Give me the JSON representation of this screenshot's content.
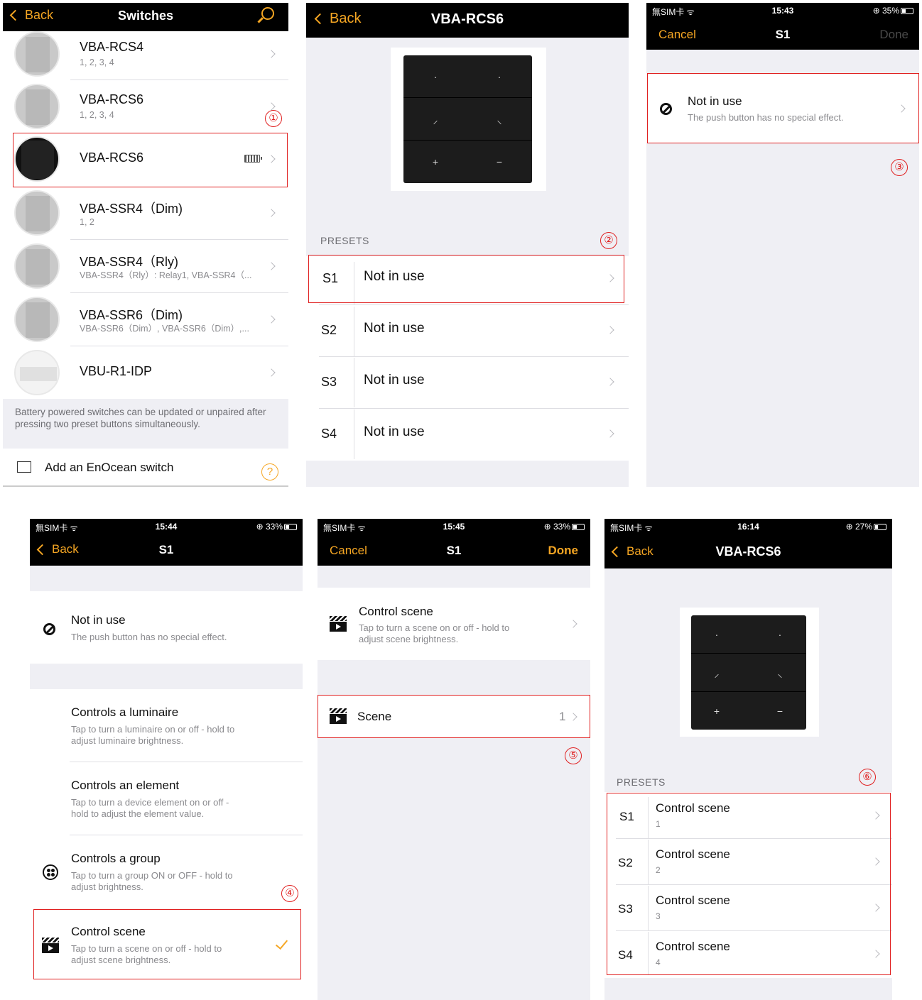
{
  "p1": {
    "back": "Back",
    "title": "Switches",
    "items": [
      {
        "name": "VBA-RCS4",
        "sub": "1, 2, 3, 4"
      },
      {
        "name": "VBA-RCS6",
        "sub": "1, 2, 3, 4"
      },
      {
        "name": "VBA-RCS6",
        "sub": ""
      },
      {
        "name": "VBA-SSR4（Dim)",
        "sub": "1, 2"
      },
      {
        "name": "VBA-SSR4（Rly)",
        "sub": "VBA-SSR4（Rly）: Relay1, VBA-SSR4（..."
      },
      {
        "name": "VBA-SSR6（Dim)",
        "sub": "VBA-SSR6（Dim）, VBA-SSR6（Dim）,..."
      },
      {
        "name": "VBU-R1-IDP",
        "sub": ""
      }
    ],
    "note": "Battery powered switches can be updated or unpaired after pressing two preset buttons simultaneously.",
    "add": "Add an EnOcean switch",
    "help": "?",
    "step": "①"
  },
  "p2": {
    "back": "Back",
    "title": "VBA-RCS6",
    "presets": "PRESETS",
    "step": "②",
    "rows": [
      {
        "s": "S1",
        "v": "Not in use"
      },
      {
        "s": "S2",
        "v": "Not in use"
      },
      {
        "s": "S3",
        "v": "Not in use"
      },
      {
        "s": "S4",
        "v": "Not in use"
      }
    ]
  },
  "device": {
    "keys": [
      "·",
      "·",
      "⸝",
      "⸜",
      "+",
      "−"
    ]
  },
  "p3": {
    "carrier": "無SIM卡 ᯤ",
    "time": "15:43",
    "battery": "⊕ 35%",
    "cancel": "Cancel",
    "title": "S1",
    "done": "Done",
    "item": {
      "name": "Not in use",
      "sub": "The push button has no special effect."
    },
    "step": "③"
  },
  "p4": {
    "carrier": "無SIM卡 ᯤ",
    "time": "15:44",
    "battery": "⊕ 33%",
    "back": "Back",
    "title": "S1",
    "first": {
      "name": "Not in use",
      "sub": "The push button has no special effect."
    },
    "items": [
      {
        "name": "Controls a luminaire",
        "sub1": "Tap to turn a luminaire on or off - hold to",
        "sub2": "adjust luminaire brightness."
      },
      {
        "name": "Controls an element",
        "sub1": "Tap to turn a device element on or off -",
        "sub2": "hold to adjust the element value."
      },
      {
        "name": "Controls a group",
        "sub1": "Tap to turn a group ON or OFF - hold to",
        "sub2": "adjust brightness."
      },
      {
        "name": "Control scene",
        "sub1": "Tap to turn a scene on or off - hold to",
        "sub2": "adjust scene brightness."
      }
    ],
    "step": "④"
  },
  "p5": {
    "carrier": "無SIM卡 ᯤ",
    "time": "15:45",
    "battery": "⊕ 33%",
    "cancel": "Cancel",
    "title": "S1",
    "done": "Done",
    "item": {
      "name": "Control scene",
      "sub1": "Tap to turn a scene on or off - hold to",
      "sub2": "adjust scene brightness."
    },
    "scene": "Scene",
    "scene_val": "1",
    "step": "⑤"
  },
  "p6": {
    "carrier": "無SIM卡 ᯤ",
    "time": "16:14",
    "battery": "⊕ 27%",
    "back": "Back",
    "title": "VBA-RCS6",
    "presets": "PRESETS",
    "step": "⑥",
    "rows": [
      {
        "s": "S1",
        "v": "Control scene",
        "n": "1"
      },
      {
        "s": "S2",
        "v": "Control scene",
        "n": "2"
      },
      {
        "s": "S3",
        "v": "Control scene",
        "n": "3"
      },
      {
        "s": "S4",
        "v": "Control scene",
        "n": "4"
      }
    ]
  },
  "colors": {
    "accent": "#f5a623",
    "highlight": "#e02020",
    "bar": "#000000"
  }
}
